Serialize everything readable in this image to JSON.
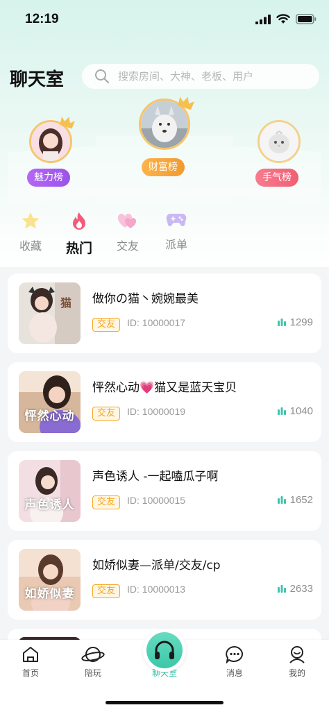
{
  "status_bar": {
    "time": "12:19"
  },
  "header": {
    "title": "聊天室",
    "search_placeholder": "搜索房间、大神、老板、用户"
  },
  "rankings": [
    {
      "label": "魅力榜",
      "color": "#a25df0"
    },
    {
      "label": "财富榜",
      "color": "#f7a23b"
    },
    {
      "label": "手气榜",
      "color": "#f46b7e"
    }
  ],
  "categories": [
    {
      "label": "收藏",
      "icon": "star-icon",
      "active": false
    },
    {
      "label": "热门",
      "icon": "flame-icon",
      "active": true
    },
    {
      "label": "交友",
      "icon": "hearts-icon",
      "active": false
    },
    {
      "label": "派单",
      "icon": "gamepad-icon",
      "active": false
    }
  ],
  "rooms": [
    {
      "title": "做你の猫丶婉婉最美",
      "thumb_text": "",
      "tag": "交友",
      "id": "ID: 10000017",
      "hot": "1299"
    },
    {
      "title": "怦然心动💗猫又是蓝天宝贝",
      "thumb_text": "怦然心动",
      "tag": "交友",
      "id": "ID: 10000019",
      "hot": "1040"
    },
    {
      "title": "声色诱人 -一起嗑瓜子啊",
      "thumb_text": "声色诱人",
      "tag": "交友",
      "id": "ID: 10000015",
      "hot": "1652"
    },
    {
      "title": "如娇似妻—派单/交友/cp",
      "thumb_text": "如娇似妻",
      "tag": "交友",
      "id": "ID: 10000013",
      "hot": "2633"
    }
  ],
  "thumb_overlay_text": "猫",
  "tabbar": {
    "items": [
      {
        "label": "首页",
        "icon": "home-icon"
      },
      {
        "label": "陪玩",
        "icon": "planet-icon"
      },
      {
        "label": "聊天室",
        "icon": "headphones-icon"
      },
      {
        "label": "消息",
        "icon": "chat-bubble-icon"
      },
      {
        "label": "我的",
        "icon": "user-icon"
      }
    ],
    "active_index": 2
  },
  "colors": {
    "accent": "#3cc7a9",
    "tag": "#f5a623",
    "hot_icon": "#3cc7a9"
  }
}
